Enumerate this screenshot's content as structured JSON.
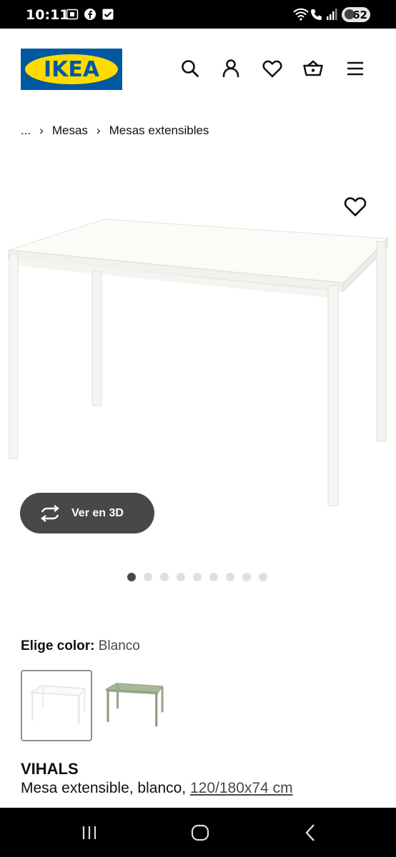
{
  "status_bar": {
    "time": "10:11",
    "battery": "62",
    "left_icons": [
      "screenshot-icon",
      "facebook-icon",
      "check-square-icon"
    ],
    "right_icons": [
      "wifi-icon",
      "wifi-call-icon",
      "signal-icon"
    ]
  },
  "header": {
    "logo_text": "IKEA",
    "brand_blue": "#0058a3",
    "brand_yellow": "#ffdb00",
    "icons": [
      "search-icon",
      "user-icon",
      "heart-icon",
      "basket-icon",
      "menu-icon"
    ]
  },
  "breadcrumb": {
    "items": [
      "...",
      "Mesas",
      "Mesas extensibles"
    ]
  },
  "gallery": {
    "view_3d_label": "Ver en 3D",
    "dot_count": 9,
    "active_index": 0
  },
  "color": {
    "label": "Elige color:",
    "value": "Blanco",
    "options": [
      "Blanco",
      "Verde"
    ]
  },
  "product": {
    "name": "VIHALS",
    "description": "Mesa extensible, blanco,",
    "size": "120/180x74 cm"
  }
}
